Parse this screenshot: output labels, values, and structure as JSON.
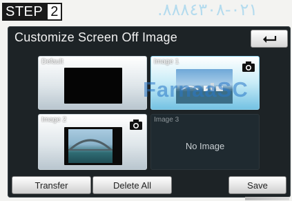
{
  "step": {
    "word": "STEP",
    "number": "2"
  },
  "watermark_top": ".٠٢١-٨٨٨٤٣٠٨",
  "screen": {
    "title": "Customize Screen Off Image",
    "back_icon": "back-arrow-icon"
  },
  "tiles": [
    {
      "label": "Default",
      "state": "light"
    },
    {
      "label": "Image 1",
      "state": "selected",
      "icon": "camera-icon"
    },
    {
      "label": "Image 2",
      "state": "light",
      "icon": "camera-icon"
    },
    {
      "label": "Image 3",
      "state": "empty",
      "empty_text": "No Image"
    }
  ],
  "buttons": {
    "transfer": "Transfer",
    "delete_all": "Delete All",
    "save": "Save"
  },
  "watermark_center": "FarnaaSC",
  "colors": {
    "screen_bg": "#1d2326",
    "selected_tile": "#74c2e3",
    "watermark": "#2a78c8"
  }
}
